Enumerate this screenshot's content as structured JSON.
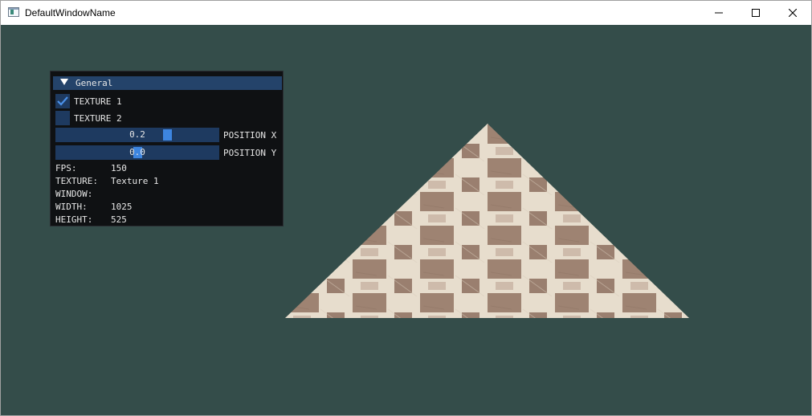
{
  "window": {
    "title": "DefaultWindowName",
    "controls": [
      "minimize-icon",
      "maximize-icon",
      "close-icon"
    ]
  },
  "colors": {
    "background": "#344d4a",
    "panel": "#0f1113",
    "header": "#24436a",
    "frame": "#1e3a60",
    "accent": "#3d85e0",
    "tile_dark": "#9a7f6f",
    "tile_light": "#e7ddcd"
  },
  "panel": {
    "header": "General",
    "checkboxes": [
      {
        "label": "TEXTURE 1",
        "checked": true
      },
      {
        "label": "TEXTURE 2",
        "checked": false
      }
    ],
    "sliders": [
      {
        "label": "POSITION X",
        "value": "0.2",
        "normalized": 0.6
      },
      {
        "label": "POSITION Y",
        "value": "0.0",
        "normalized": 0.5
      }
    ],
    "stats": [
      {
        "key": "FPS:",
        "value": "150"
      },
      {
        "key": "TEXTURE:",
        "value": "Texture 1"
      },
      {
        "key": "WINDOW:",
        "value": ""
      },
      {
        "key": "WIDTH:",
        "value": "1025"
      },
      {
        "key": "HEIGHT:",
        "value": "525"
      }
    ]
  },
  "scene": {
    "object": "textured-triangle",
    "texture": "Texture 1"
  }
}
